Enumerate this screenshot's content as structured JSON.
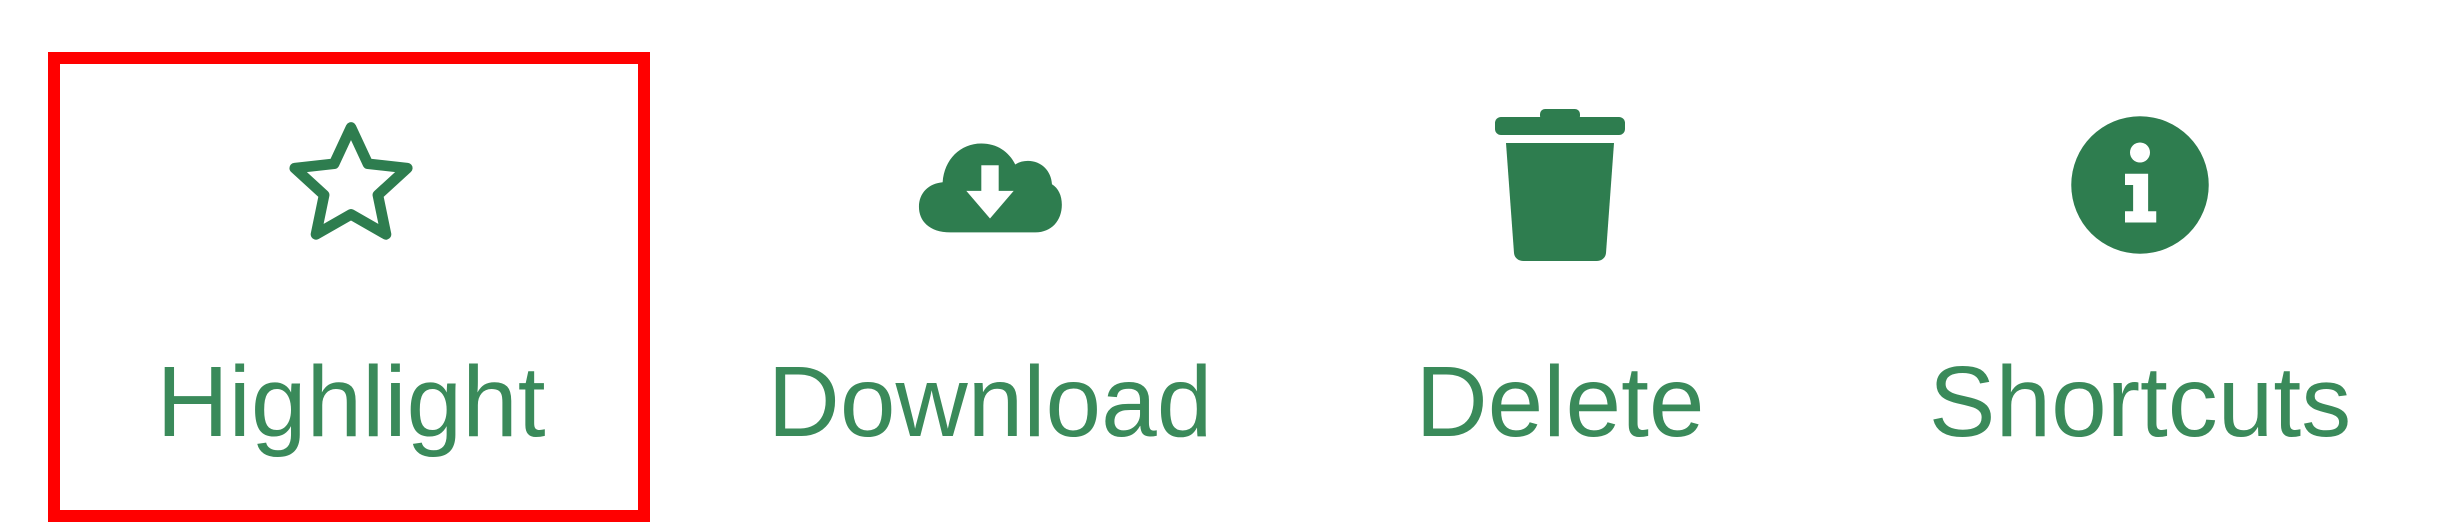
{
  "toolbar": {
    "items": [
      {
        "label": "Highlight",
        "icon": "star-outline-icon",
        "selected": true
      },
      {
        "label": "Download",
        "icon": "cloud-download-icon",
        "selected": false
      },
      {
        "label": "Delete",
        "icon": "trash-icon",
        "selected": false
      },
      {
        "label": "Shortcuts",
        "icon": "info-circle-icon",
        "selected": false
      }
    ]
  },
  "colors": {
    "accent": "#2e7d4f",
    "label": "#3a8a5a",
    "selection": "#ff0000",
    "background": "#ffffff"
  }
}
